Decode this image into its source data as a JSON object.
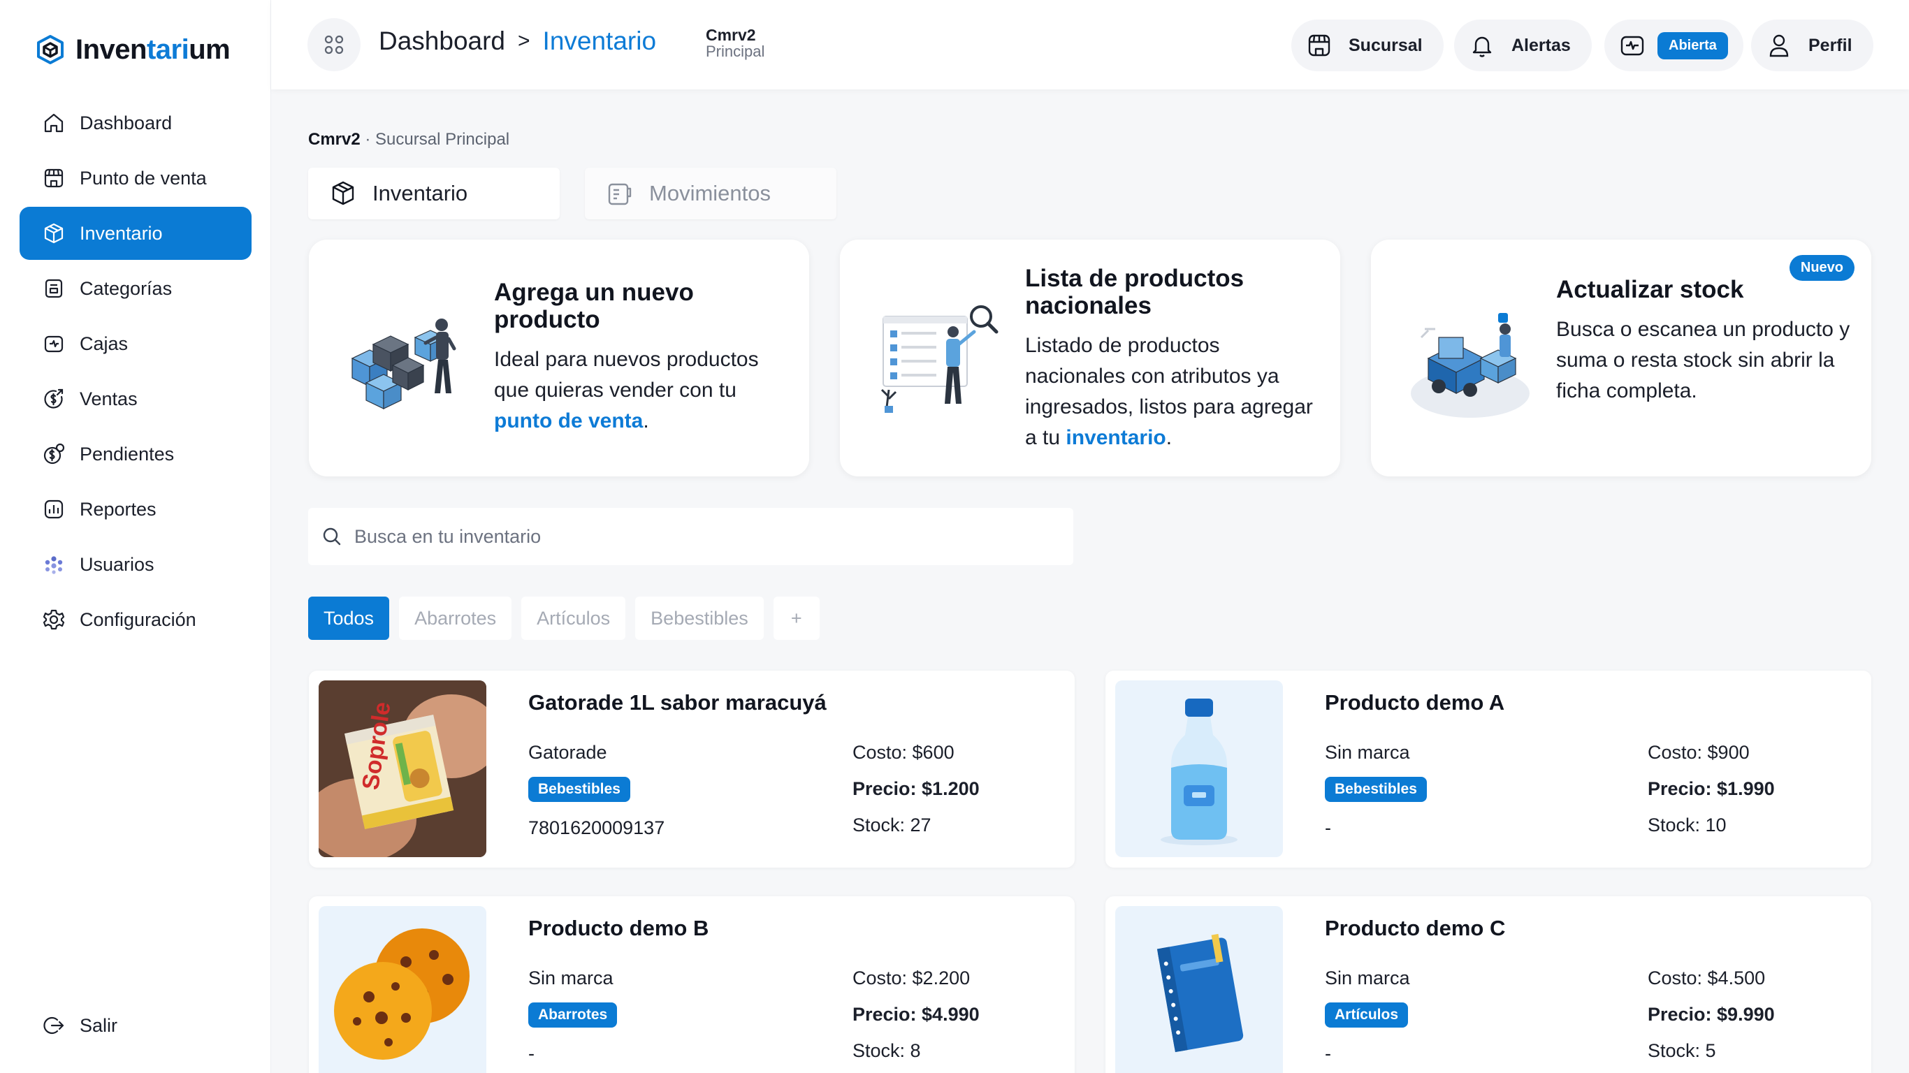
{
  "app": {
    "logo_prefix": "Inven",
    "logo_accent": "tari",
    "logo_suffix": "um"
  },
  "sidebar": {
    "items": [
      {
        "label": "Dashboard",
        "icon": "home-icon"
      },
      {
        "label": "Punto de venta",
        "icon": "store-icon"
      },
      {
        "label": "Inventario",
        "icon": "box-icon",
        "active": true
      },
      {
        "label": "Categorías",
        "icon": "tag-icon"
      },
      {
        "label": "Cajas",
        "icon": "register-icon"
      },
      {
        "label": "Ventas",
        "icon": "sales-icon"
      },
      {
        "label": "Pendientes",
        "icon": "pending-icon"
      },
      {
        "label": "Reportes",
        "icon": "chart-icon"
      },
      {
        "label": "Usuarios",
        "icon": "users-icon"
      },
      {
        "label": "Configuración",
        "icon": "gear-icon"
      }
    ],
    "logout_label": "Salir"
  },
  "header": {
    "breadcrumb_root": "Dashboard",
    "breadcrumb_sep": ">",
    "breadcrumb_current": "Inventario",
    "branch_name": "Cmrv2",
    "branch_sub": "Principal",
    "branch_button": "Sucursal",
    "alerts_button": "Alertas",
    "register_status": "Abierta",
    "profile_button": "Perfil"
  },
  "main": {
    "branch_bold": "Cmrv2",
    "branch_rest": " · Sucursal Principal",
    "tabs": [
      {
        "label": "Inventario",
        "active": true
      },
      {
        "label": "Movimientos",
        "active": false
      }
    ],
    "features": [
      {
        "title": "Agrega un nuevo producto",
        "text": "Ideal para nuevos productos que quieras vender con tu ",
        "link": "punto de venta",
        "after": "."
      },
      {
        "title": "Lista de productos nacionales",
        "text": "Listado de productos nacionales con atributos ya ingresados, listos para agregar a tu ",
        "link": "inventario",
        "after": "."
      },
      {
        "title": "Actualizar stock",
        "text": "Busca o escanea un producto y suma o resta stock sin abrir la ficha completa.",
        "badge": "Nuevo"
      }
    ],
    "search": {
      "placeholder": "Busca en tu inventario",
      "value": ""
    },
    "filters": [
      "Todos",
      "Abarrotes",
      "Artículos",
      "Bebestibles",
      "+"
    ],
    "products": [
      {
        "name": "Gatorade 1L sabor maracuyá",
        "brand": "Gatorade",
        "category": "Bebestibles",
        "code": "7801620009137",
        "cost": "Costo: $600",
        "price": "Precio: $1.200",
        "stock": "Stock: 27"
      },
      {
        "name": "Producto demo A",
        "brand": "Sin marca",
        "category": "Bebestibles",
        "code": "-",
        "cost": "Costo: $900",
        "price": "Precio: $1.990",
        "stock": "Stock: 10"
      },
      {
        "name": "Producto demo B",
        "brand": "Sin marca",
        "category": "Abarrotes",
        "code": "-",
        "cost": "Costo: $2.200",
        "price": "Precio: $4.990",
        "stock": "Stock: 8"
      },
      {
        "name": "Producto demo C",
        "brand": "Sin marca",
        "category": "Artículos",
        "code": "-",
        "cost": "Costo: $4.500",
        "price": "Precio: $9.990",
        "stock": "Stock: 5"
      }
    ],
    "product_images": [
      "yogurt-cup-photo",
      "water-bottle-icon",
      "cookies-icon",
      "notebook-icon"
    ]
  },
  "colors": {
    "accent": "#0b7bd4",
    "link": "#0d7bd6",
    "background": "#f6f7f9",
    "thumb_bg": "#eaf3fc"
  }
}
